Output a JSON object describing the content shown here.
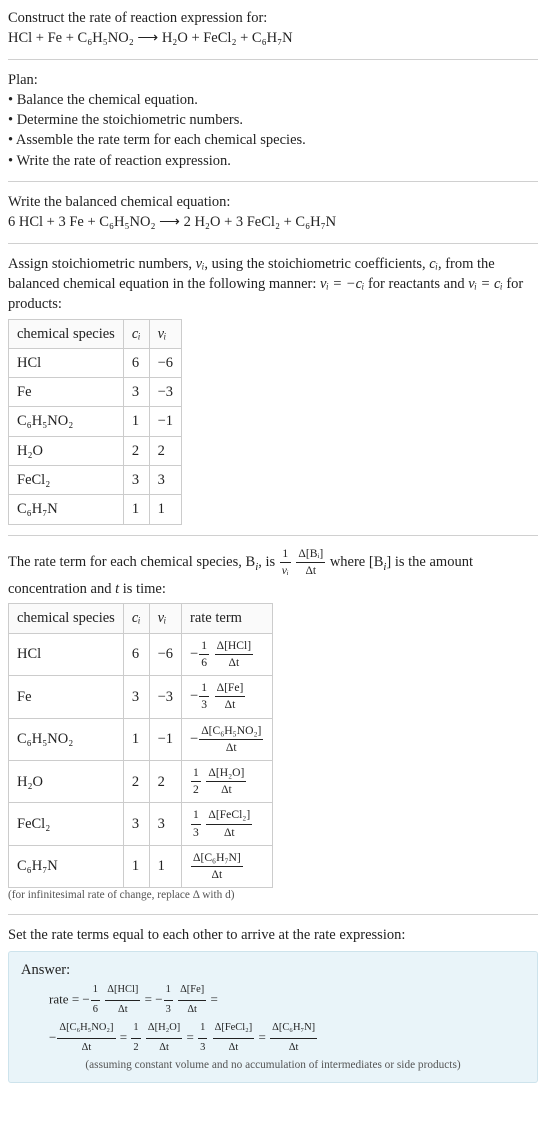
{
  "header": {
    "prompt": "Construct the rate of reaction expression for:",
    "equation": "HCl + Fe + C₆H₅NO₂  ⟶  H₂O + FeCl₂ + C₆H₇N"
  },
  "plan": {
    "title": "Plan:",
    "items": [
      "Balance the chemical equation.",
      "Determine the stoichiometric numbers.",
      "Assemble the rate term for each chemical species.",
      "Write the rate of reaction expression."
    ]
  },
  "balanced": {
    "title": "Write the balanced chemical equation:",
    "equation": "6 HCl + 3 Fe + C₆H₅NO₂  ⟶  2 H₂O + 3 FeCl₂ + C₆H₇N"
  },
  "stoich": {
    "intro_a": "Assign stoichiometric numbers, ",
    "intro_b": ", using the stoichiometric coefficients, ",
    "intro_c": ", from the balanced chemical equation in the following manner: ",
    "intro_d": " for reactants and ",
    "intro_e": " for products:",
    "nu": "νᵢ",
    "ci": "cᵢ",
    "rel_react": "νᵢ = −cᵢ",
    "rel_prod": "νᵢ = cᵢ",
    "cols": {
      "species": "chemical species",
      "c": "cᵢ",
      "v": "νᵢ"
    },
    "rows": [
      {
        "species": "HCl",
        "c": "6",
        "v": "−6"
      },
      {
        "species": "Fe",
        "c": "3",
        "v": "−3"
      },
      {
        "species": "C₆H₅NO₂",
        "c": "1",
        "v": "−1"
      },
      {
        "species": "H₂O",
        "c": "2",
        "v": "2"
      },
      {
        "species": "FeCl₂",
        "c": "3",
        "v": "3"
      },
      {
        "species": "C₆H₇N",
        "c": "1",
        "v": "1"
      }
    ]
  },
  "rateterm": {
    "intro_a": "The rate term for each chemical species, B",
    "intro_b": ", is ",
    "intro_c": " where [B",
    "intro_d": "] is the amount concentration and ",
    "intro_e": " is time:",
    "t": "t",
    "frac1_top": "1",
    "frac1_bot": "νᵢ",
    "frac2_top": "Δ[Bᵢ]",
    "frac2_bot": "Δt",
    "cols": {
      "species": "chemical species",
      "c": "cᵢ",
      "v": "νᵢ",
      "rate": "rate term"
    },
    "rows": [
      {
        "species": "HCl",
        "c": "6",
        "v": "−6",
        "sign": "−",
        "coef_top": "1",
        "coef_bot": "6",
        "dnum": "Δ[HCl]",
        "dden": "Δt"
      },
      {
        "species": "Fe",
        "c": "3",
        "v": "−3",
        "sign": "−",
        "coef_top": "1",
        "coef_bot": "3",
        "dnum": "Δ[Fe]",
        "dden": "Δt"
      },
      {
        "species": "C₆H₅NO₂",
        "c": "1",
        "v": "−1",
        "sign": "−",
        "coef_top": "",
        "coef_bot": "",
        "dnum": "Δ[C₆H₅NO₂]",
        "dden": "Δt"
      },
      {
        "species": "H₂O",
        "c": "2",
        "v": "2",
        "sign": "",
        "coef_top": "1",
        "coef_bot": "2",
        "dnum": "Δ[H₂O]",
        "dden": "Δt"
      },
      {
        "species": "FeCl₂",
        "c": "3",
        "v": "3",
        "sign": "",
        "coef_top": "1",
        "coef_bot": "3",
        "dnum": "Δ[FeCl₂]",
        "dden": "Δt"
      },
      {
        "species": "C₆H₇N",
        "c": "1",
        "v": "1",
        "sign": "",
        "coef_top": "",
        "coef_bot": "",
        "dnum": "Δ[C₆H₇N]",
        "dden": "Δt"
      }
    ],
    "note": "(for infinitesimal rate of change, replace Δ with d)"
  },
  "final": {
    "intro": "Set the rate terms equal to each other to arrive at the rate expression:",
    "answer_label": "Answer:",
    "rate_word": "rate = ",
    "terms": [
      {
        "sign": "−",
        "coef_top": "1",
        "coef_bot": "6",
        "dnum": "Δ[HCl]",
        "dden": "Δt"
      },
      {
        "sign": "−",
        "coef_top": "1",
        "coef_bot": "3",
        "dnum": "Δ[Fe]",
        "dden": "Δt"
      },
      {
        "sign": "−",
        "coef_top": "",
        "coef_bot": "",
        "dnum": "Δ[C₆H₅NO₂]",
        "dden": "Δt"
      },
      {
        "sign": "",
        "coef_top": "1",
        "coef_bot": "2",
        "dnum": "Δ[H₂O]",
        "dden": "Δt"
      },
      {
        "sign": "",
        "coef_top": "1",
        "coef_bot": "3",
        "dnum": "Δ[FeCl₂]",
        "dden": "Δt"
      },
      {
        "sign": "",
        "coef_top": "",
        "coef_bot": "",
        "dnum": "Δ[C₆H₇N]",
        "dden": "Δt"
      }
    ],
    "eq": " = ",
    "assumption": "(assuming constant volume and no accumulation of intermediates or side products)"
  }
}
